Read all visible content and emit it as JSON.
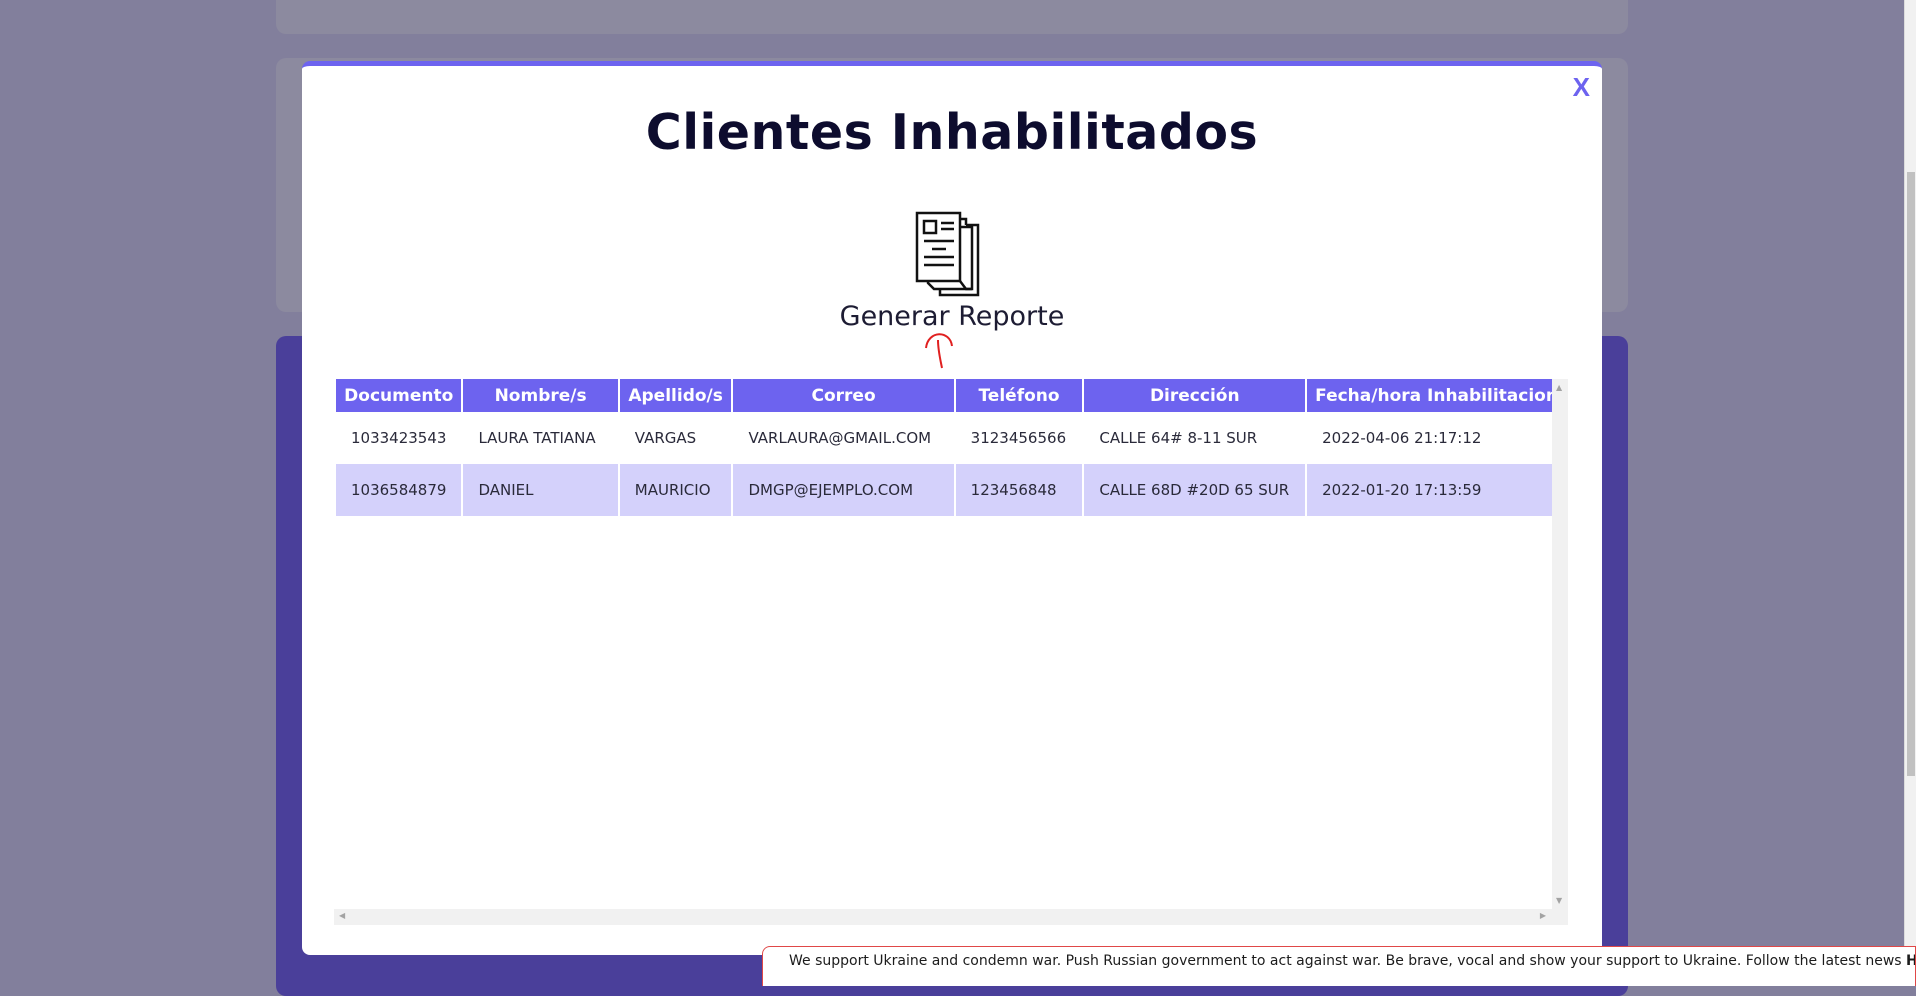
{
  "modal": {
    "title": "Clientes Inhabilitados",
    "close_label": "X",
    "report_button_label": "Generar Reporte"
  },
  "table": {
    "columns": [
      "Documento",
      "Nombre/s",
      "Apellido/s",
      "Correo",
      "Teléfono",
      "Dirección",
      "Fecha/hora Inhabilitacion"
    ],
    "rows": [
      [
        "1033423543",
        "LAURA TATIANA",
        "VARGAS",
        "VARLAURA@GMAIL.COM",
        "3123456566",
        "CALLE 64# 8-11 SUR",
        "2022-04-06 21:17:12"
      ],
      [
        "1036584879",
        "DANIEL",
        "MAURICIO",
        "DMGP@EJEMPLO.COM",
        "123456848",
        "CALLE 68D #20D 65 SUR",
        "2022-01-20 17:13:59"
      ]
    ]
  },
  "notice": {
    "text": "We support Ukraine and condemn war. Push Russian government to act against war. Be brave, vocal and show your support to Ukraine. Follow the latest news",
    "link_label": "HERE"
  },
  "colors": {
    "accent": "#6d63ef",
    "row_alt": "#d4d1fb",
    "overlay": "#827f9c"
  }
}
